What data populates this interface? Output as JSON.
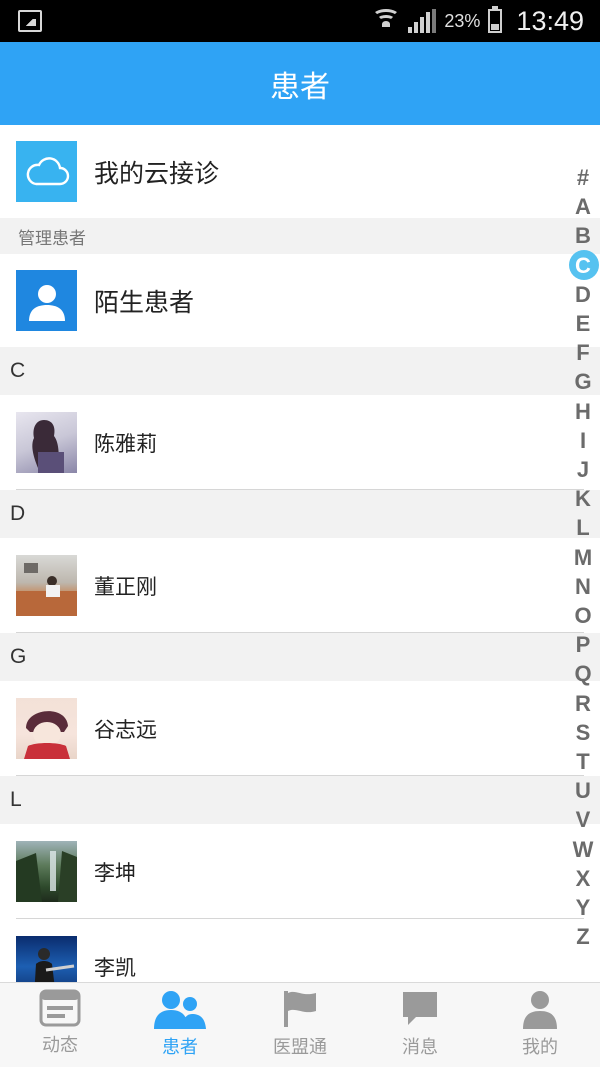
{
  "status_bar": {
    "battery": "23%",
    "time": "13:49"
  },
  "header": {
    "title": "患者"
  },
  "cloud_item": {
    "label": "我的云接诊"
  },
  "manage_section": {
    "label": "管理患者"
  },
  "stranger_item": {
    "label": "陌生患者"
  },
  "groups": [
    {
      "letter": "C",
      "contacts": [
        {
          "name": "陈雅莉"
        }
      ]
    },
    {
      "letter": "D",
      "contacts": [
        {
          "name": "董正刚"
        }
      ]
    },
    {
      "letter": "G",
      "contacts": [
        {
          "name": "谷志远"
        }
      ]
    },
    {
      "letter": "L",
      "contacts": [
        {
          "name": "李坤"
        },
        {
          "name": "李凯"
        }
      ]
    }
  ],
  "index_letters": [
    "#",
    "A",
    "B",
    "C",
    "D",
    "E",
    "F",
    "G",
    "H",
    "I",
    "J",
    "K",
    "L",
    "M",
    "N",
    "O",
    "P",
    "Q",
    "R",
    "S",
    "T",
    "U",
    "V",
    "W",
    "X",
    "Y",
    "Z"
  ],
  "index_active": "C",
  "tabs": [
    {
      "label": "动态",
      "icon": "feed-icon",
      "active": false
    },
    {
      "label": "患者",
      "icon": "patients-icon",
      "active": true
    },
    {
      "label": "医盟通",
      "icon": "flag-icon",
      "active": false
    },
    {
      "label": "消息",
      "icon": "message-icon",
      "active": false
    },
    {
      "label": "我的",
      "icon": "profile-icon",
      "active": false
    }
  ],
  "colors": {
    "accent": "#2fa3f5",
    "inactive": "#9a9a9a",
    "index_bubble": "#56c2f0"
  }
}
